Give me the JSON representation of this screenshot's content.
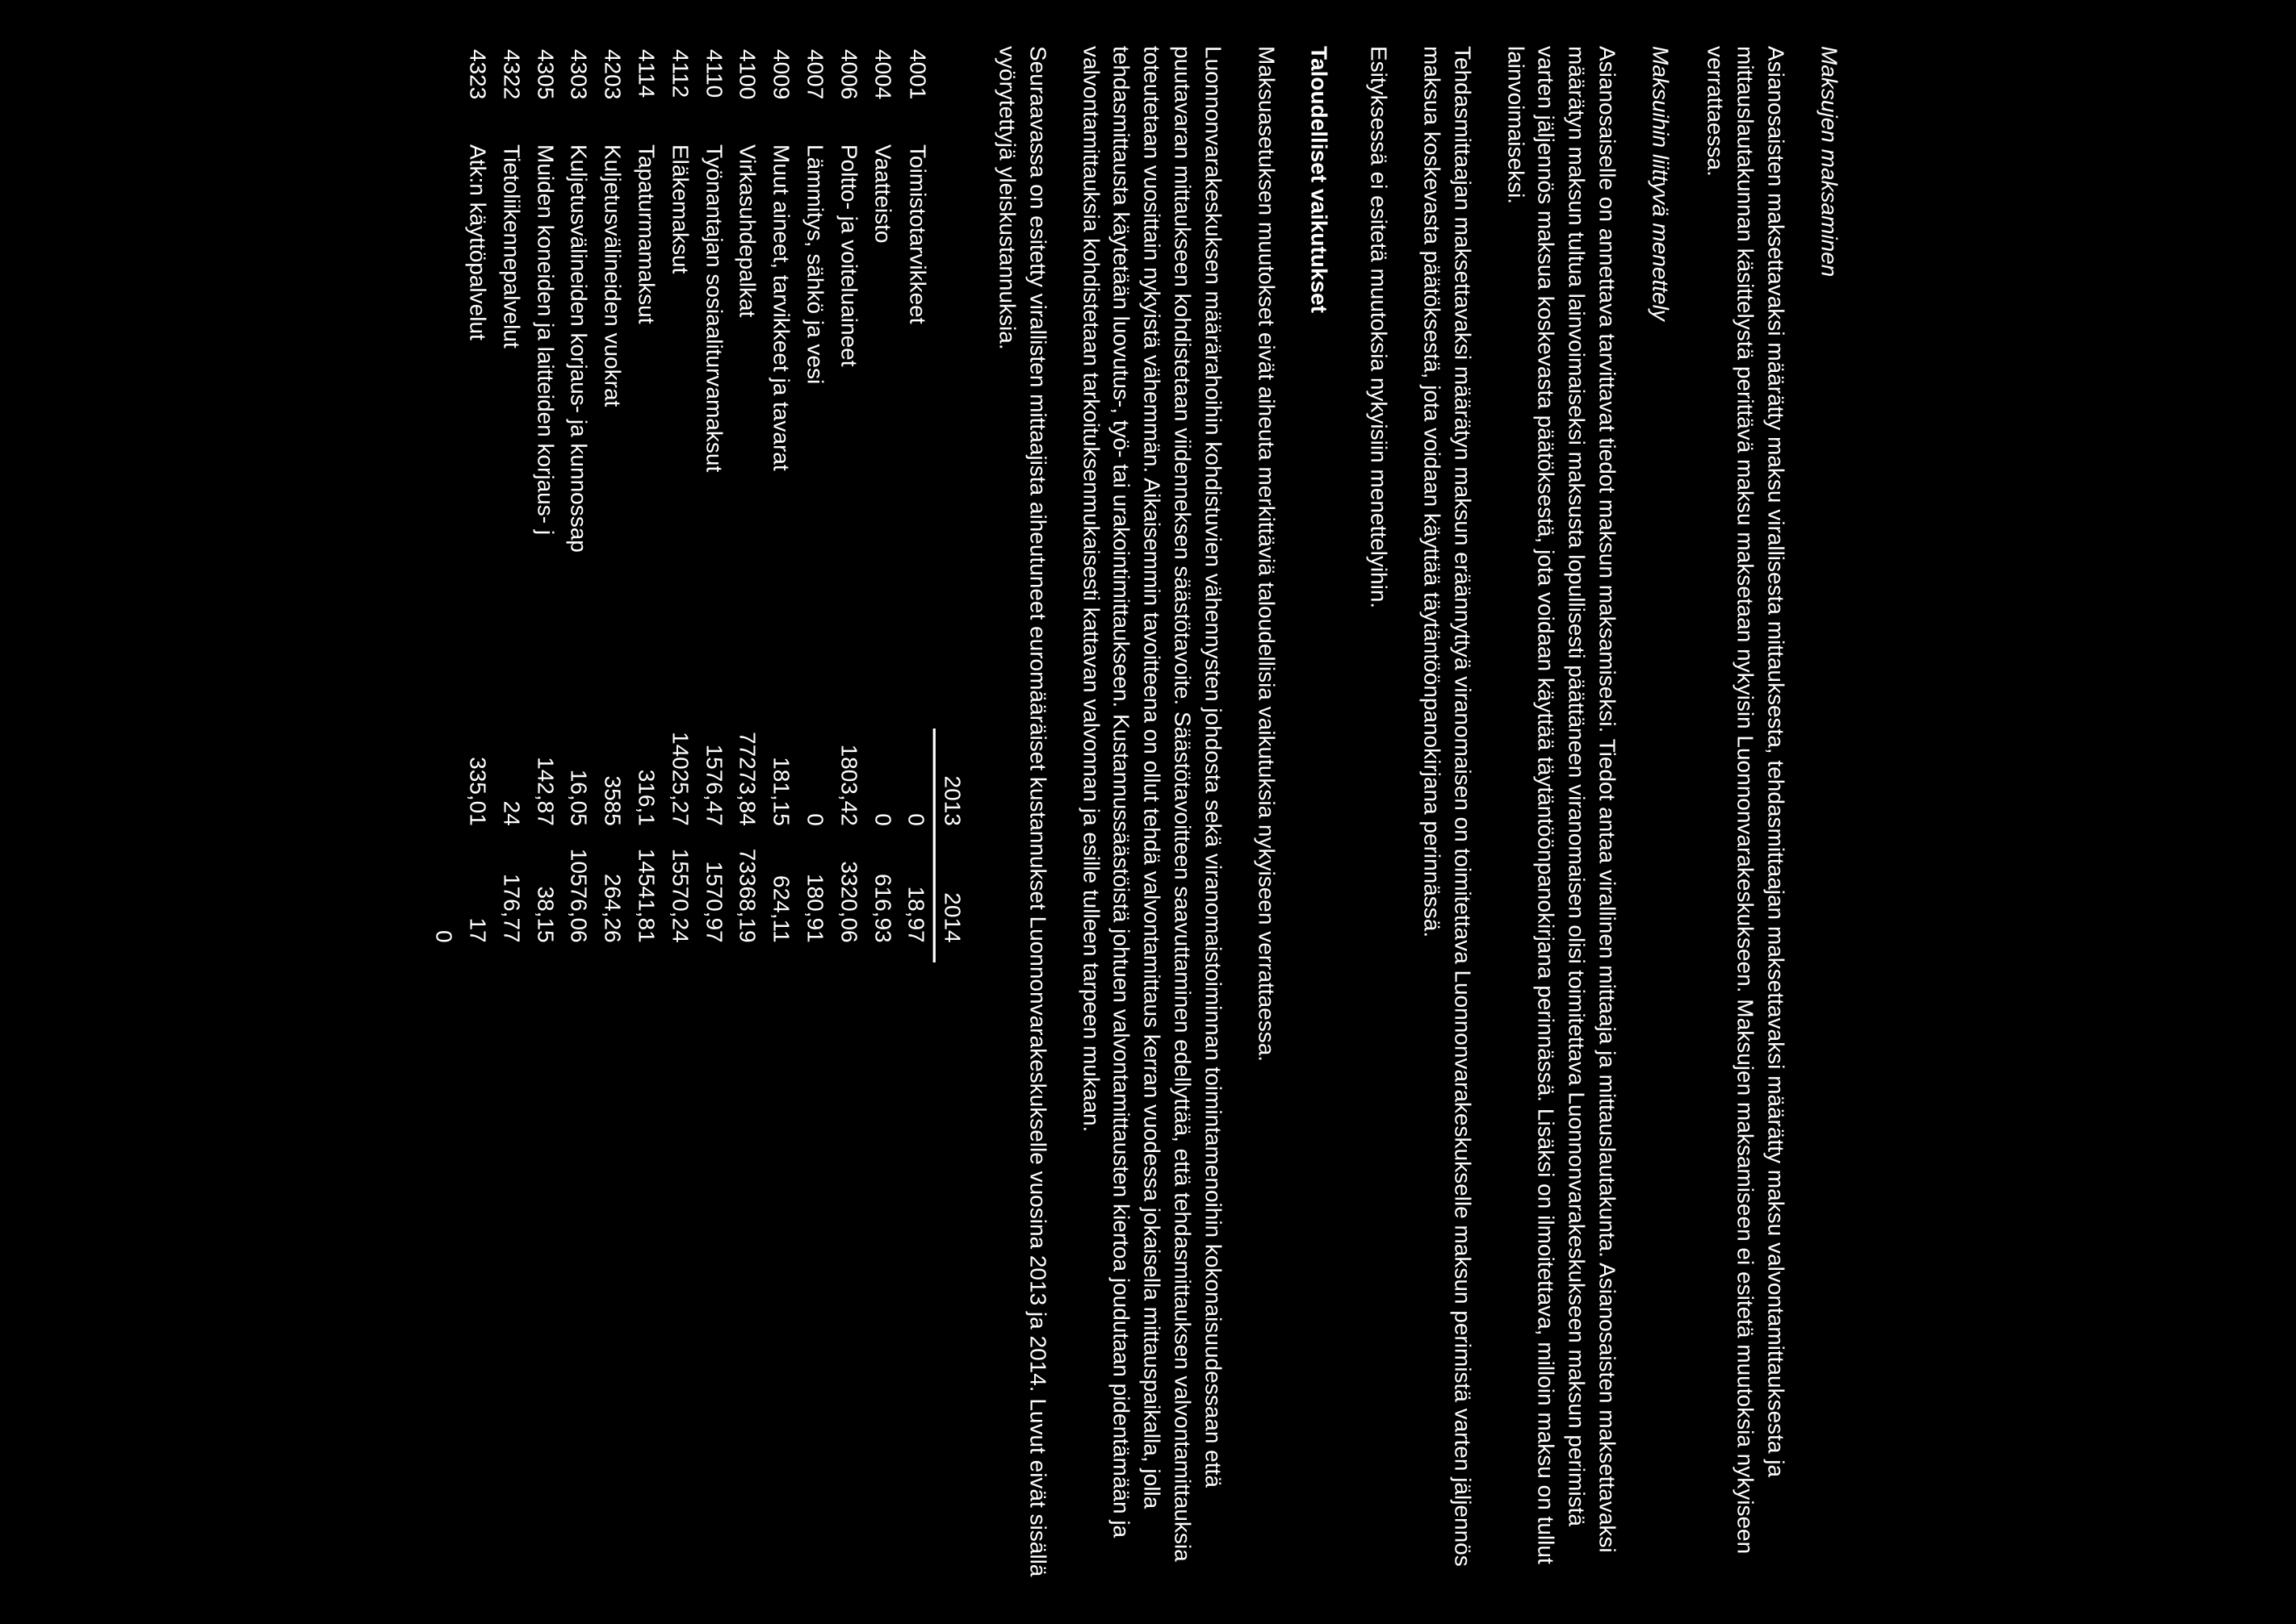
{
  "headings": {
    "h1": "Maksujen maksaminen",
    "h2": "Maksuihin liittyvä menettely",
    "h3": "Taloudelliset vaikutukset"
  },
  "paragraphs": {
    "p1": "Asianosaisten maksettavaksi määrätty maksu virallisesta mittauksesta, tehdasmittaajan maksettavaksi määrätty maksu valvontamittauksesta ja mittauslautakunnan käsittelystä perittävä maksu maksetaan nykyisin Luonnonvarakeskukseen. Maksujen maksamiseen ei esitetä muutoksia nykyiseen verrattaessa.",
    "p2": "Asianosaiselle on annettava tarvittavat tiedot maksun maksamiseksi. Tiedot antaa virallinen mittaaja ja mittauslautakunta. Asianosaisten maksettavaksi määrätyn maksun tultua lainvoimaiseksi maksusta lopullisesti päättäneen viranomaisen olisi toimitettava Luonnonvarakeskukseen maksun perimistä varten jäljennös maksua koskevasta päätöksestä, jota voidaan käyttää täytäntöönpanokirjana perinnässä. Lisäksi on ilmoitettava, milloin maksu on tullut lainvoimaiseksi.",
    "p3": "Tehdasmittaajan maksettavaksi määrätyn maksun eräännyttyä viranomaisen on toimitettava Luonnonvarakeskukselle maksun perimistä varten jäljennös maksua koskevasta päätöksestä, jota voidaan käyttää täytäntöönpanokirjana perinnässä.",
    "p4": "Esityksessä ei esitetä muutoksia nykyisiin menettelyihin.",
    "p5": "Maksuasetuksen muutokset eivät aiheuta merkittäviä taloudellisia vaikutuksia nykyiseen verrattaessa.",
    "p6": "Luonnonvarakeskuksen määrärahoihin kohdistuvien vähennysten johdosta sekä viranomaistoiminnan toimintamenoihin kokonaisuudessaan että puutavaran mittaukseen kohdistetaan viidenneksen säästötavoite. Säästötavoitteen saavuttaminen edellyttää, että tehdasmittauksen valvontamittauksia toteutetaan vuosittain nykyistä vähemmän. Aikaisemmin tavoitteena on ollut tehdä valvontamittaus kerran vuodessa jokaisella mittauspaikalla, jolla tehdasmittausta käytetään luovutus-, työ- tai urakointimittaukseen. Kustannussäästöistä johtuen valvontamittausten kiertoa joudutaan pidentämään ja valvontamittauksia kohdistetaan tarkoituksenmukaisesti kattavan valvonnan ja esille tulleen tarpeen mukaan.",
    "p7": "Seuraavassa on esitetty virallisten mittaajista aiheutuneet euromääräiset kustannukset Luonnonvarakeskukselle vuosina 2013 ja 2014. Luvut eivät sisällä vyörytettyjä yleiskustannuksia."
  },
  "table": {
    "headers": {
      "y1": "2013",
      "y2": "2014"
    },
    "rows": [
      {
        "code": "4001",
        "label": "Toimistotarvikkeet",
        "y1": "0",
        "y2": "18,97"
      },
      {
        "code": "4004",
        "label": "Vaatteisto",
        "y1": "0",
        "y2": "616,93"
      },
      {
        "code": "4006",
        "label": "Poltto- ja voiteluaineet",
        "y1": "1803,42",
        "y2": "3320,06"
      },
      {
        "code": "4007",
        "label": "Lämmitys, sähkö ja vesi",
        "y1": "0",
        "y2": "180,91"
      },
      {
        "code": "4009",
        "label": "Muut aineet, tarvikkeet ja tavarat",
        "y1": "181,15",
        "y2": "624,11"
      },
      {
        "code": "4100",
        "label": "Virkasuhdepalkat",
        "y1": "77273,84",
        "y2": "73368,19"
      },
      {
        "code": "4110",
        "label": "Työnantajan sosiaaliturvamaksut",
        "y1": "1576,47",
        "y2": "1570,97"
      },
      {
        "code": "4112",
        "label": "Eläkemaksut",
        "y1": "14025,27",
        "y2": "15570,24"
      },
      {
        "code": "4114",
        "label": "Tapaturmamaksut",
        "y1": "316,1",
        "y2": "14541,81"
      },
      {
        "code": "4203",
        "label": "Kuljetusvälineiden vuokrat",
        "y1": "3585",
        "y2": "264,26"
      },
      {
        "code": "4303",
        "label": "Kuljetusvälineiden korjaus- ja kunnossap",
        "y1": "16,05",
        "y2": "10576,06"
      },
      {
        "code": "4305",
        "label": "Muiden koneiden ja laitteiden korjaus- j",
        "y1": "142,87",
        "y2": "38,15"
      },
      {
        "code": "4322",
        "label": "Tietoliikennepalvelut",
        "y1": "24",
        "y2": "176,77"
      },
      {
        "code": "4323",
        "label": "Atk:n käyttöpalvelut",
        "y1": "335,01",
        "y2": "17"
      },
      {
        "code": "",
        "label": "",
        "y1": "",
        "y2": "0"
      }
    ]
  }
}
